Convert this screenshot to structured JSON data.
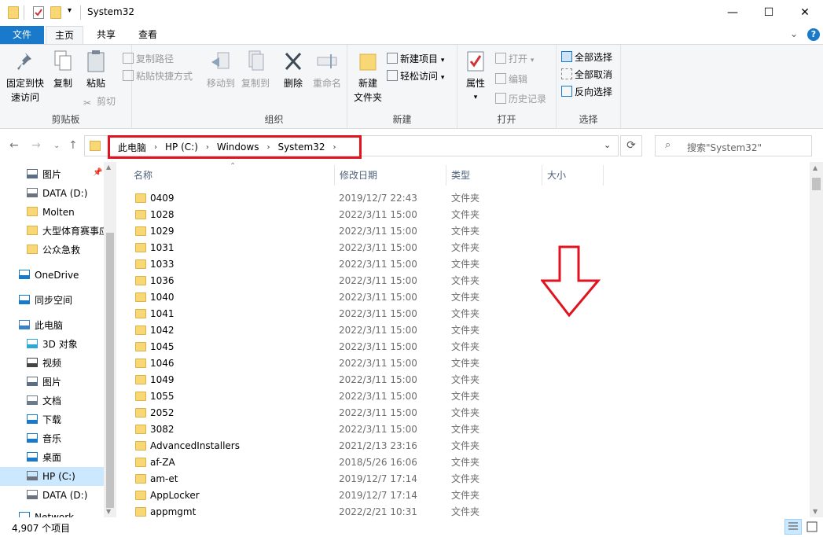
{
  "window": {
    "title": "System32",
    "minimize_label": "—",
    "maximize_label": "☐",
    "close_label": "✕"
  },
  "tabs": [
    "文件",
    "主页",
    "共享",
    "查看"
  ],
  "ribbon": {
    "clipboard": {
      "label": "剪贴板",
      "pin_label_1": "固定到快",
      "pin_label_2": "速访问",
      "copy_label": "复制",
      "paste_label": "粘贴",
      "copy_path_label": "复制路径",
      "paste_shortcut_label": "粘贴快捷方式",
      "cut_label": "剪切"
    },
    "organize": {
      "label": "组织",
      "move_to_label": "移动到",
      "copy_to_label": "复制到",
      "delete_label": "删除",
      "rename_label": "重命名"
    },
    "new": {
      "label": "新建",
      "new_folder_label_1": "新建",
      "new_folder_label_2": "文件夹",
      "new_item_label": "新建项目",
      "easy_access_label": "轻松访问"
    },
    "open": {
      "label": "打开",
      "properties_label": "属性",
      "open_label": "打开",
      "edit_label": "编辑",
      "history_label": "历史记录"
    },
    "select": {
      "label": "选择",
      "select_all_label": "全部选择",
      "select_none_label": "全部取消",
      "invert_label": "反向选择"
    }
  },
  "address": {
    "crumbs": [
      "此电脑",
      "HP (C:)",
      "Windows",
      "System32"
    ],
    "search_placeholder": "搜索\"System32\""
  },
  "nav_pane": {
    "items": [
      {
        "label": "图片",
        "icon": "pictures-icon",
        "indent": 1
      },
      {
        "label": "DATA (D:)",
        "icon": "drive-icon",
        "indent": 1
      },
      {
        "label": "Molten",
        "icon": "folder-icon",
        "indent": 1
      },
      {
        "label": "大型体育赛事应",
        "icon": "folder-icon",
        "indent": 1
      },
      {
        "label": "公众急救",
        "icon": "folder-icon",
        "indent": 1
      },
      {
        "label": "OneDrive",
        "icon": "onedrive-icon",
        "indent": 0
      },
      {
        "label": "同步空间",
        "icon": "sync-icon",
        "indent": 0
      },
      {
        "label": "此电脑",
        "icon": "computer-icon",
        "indent": 0
      },
      {
        "label": "3D 对象",
        "icon": "3d-objects-icon",
        "indent": 1
      },
      {
        "label": "视频",
        "icon": "video-icon",
        "indent": 1
      },
      {
        "label": "图片",
        "icon": "pictures-icon",
        "indent": 1
      },
      {
        "label": "文档",
        "icon": "documents-icon",
        "indent": 1
      },
      {
        "label": "下载",
        "icon": "download-icon",
        "indent": 1
      },
      {
        "label": "音乐",
        "icon": "music-icon",
        "indent": 1
      },
      {
        "label": "桌面",
        "icon": "desktop-icon",
        "indent": 1
      },
      {
        "label": "HP (C:)",
        "icon": "drive-c-icon",
        "indent": 1,
        "selected": true
      },
      {
        "label": "DATA (D:)",
        "icon": "drive-icon",
        "indent": 1
      },
      {
        "label": "Network",
        "icon": "network-icon",
        "indent": 0
      }
    ]
  },
  "columns": {
    "name": "名称",
    "date": "修改日期",
    "type": "类型",
    "size": "大小"
  },
  "files": [
    {
      "name": "0409",
      "date": "2019/12/7 22:43",
      "type": "文件夹"
    },
    {
      "name": "1028",
      "date": "2022/3/11 15:00",
      "type": "文件夹"
    },
    {
      "name": "1029",
      "date": "2022/3/11 15:00",
      "type": "文件夹"
    },
    {
      "name": "1031",
      "date": "2022/3/11 15:00",
      "type": "文件夹"
    },
    {
      "name": "1033",
      "date": "2022/3/11 15:00",
      "type": "文件夹"
    },
    {
      "name": "1036",
      "date": "2022/3/11 15:00",
      "type": "文件夹"
    },
    {
      "name": "1040",
      "date": "2022/3/11 15:00",
      "type": "文件夹"
    },
    {
      "name": "1041",
      "date": "2022/3/11 15:00",
      "type": "文件夹"
    },
    {
      "name": "1042",
      "date": "2022/3/11 15:00",
      "type": "文件夹"
    },
    {
      "name": "1045",
      "date": "2022/3/11 15:00",
      "type": "文件夹"
    },
    {
      "name": "1046",
      "date": "2022/3/11 15:00",
      "type": "文件夹"
    },
    {
      "name": "1049",
      "date": "2022/3/11 15:00",
      "type": "文件夹"
    },
    {
      "name": "1055",
      "date": "2022/3/11 15:00",
      "type": "文件夹"
    },
    {
      "name": "2052",
      "date": "2022/3/11 15:00",
      "type": "文件夹"
    },
    {
      "name": "3082",
      "date": "2022/3/11 15:00",
      "type": "文件夹"
    },
    {
      "name": "AdvancedInstallers",
      "date": "2021/2/13 23:16",
      "type": "文件夹"
    },
    {
      "name": "af-ZA",
      "date": "2018/5/26 16:06",
      "type": "文件夹"
    },
    {
      "name": "am-et",
      "date": "2019/12/7 17:14",
      "type": "文件夹"
    },
    {
      "name": "AppLocker",
      "date": "2019/12/7 17:14",
      "type": "文件夹"
    },
    {
      "name": "appmgmt",
      "date": "2022/2/21 10:31",
      "type": "文件夹"
    }
  ],
  "status": {
    "count": "4,907 个项目"
  },
  "colors": {
    "file_tab": "#1979ca",
    "highlight_box": "#e0131f",
    "annotation_arrow": "#e0131f",
    "selected_nav": "#cce8ff"
  }
}
